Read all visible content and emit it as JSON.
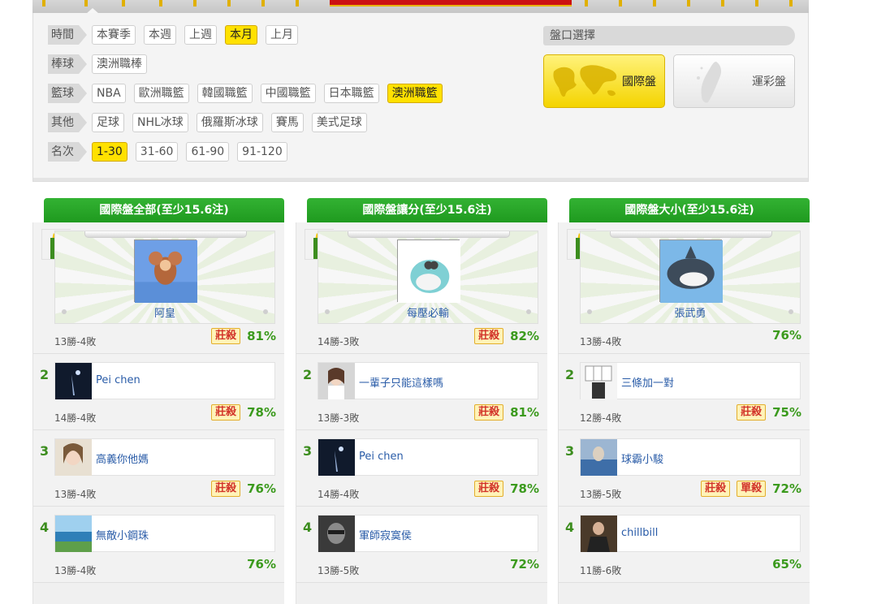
{
  "filters": {
    "time": {
      "label": "時間",
      "options": [
        "本賽季",
        "本週",
        "上週",
        "本月",
        "上月"
      ],
      "active": 3
    },
    "baseball": {
      "label": "棒球",
      "options": [
        "澳洲職棒"
      ],
      "active": -1
    },
    "basketball": {
      "label": "籃球",
      "options": [
        "NBA",
        "歐洲職籃",
        "韓國職籃",
        "中國職籃",
        "日本職籃",
        "澳洲職籃"
      ],
      "active": 5
    },
    "other": {
      "label": "其他",
      "options": [
        "足球",
        "NHL冰球",
        "俄羅斯冰球",
        "賽馬",
        "美式足球"
      ],
      "active": -1
    },
    "rank": {
      "label": "名次",
      "options": [
        "1-30",
        "31-60",
        "61-90",
        "91-120"
      ],
      "active": 0
    }
  },
  "odds": {
    "title": "盤口選擇",
    "international": "國際盤",
    "taiwan": "運彩盤"
  },
  "colors": {
    "accent_yellow": "#ffe100",
    "header_green": "#2aa52a",
    "pct_green": "#3b9a1d",
    "badge_red": "#d2342a"
  },
  "columns": [
    {
      "title": "國際盤全部(至少15.6注)",
      "entries": [
        {
          "rank": "1",
          "name": "阿皇",
          "record": "13勝-4敗",
          "badges": [
            "莊殺"
          ],
          "pct": "81%",
          "avatar": "jerry-mouse"
        },
        {
          "rank": "2",
          "name": "Pei chen",
          "record": "14勝-4敗",
          "badges": [
            "莊殺"
          ],
          "pct": "78%",
          "avatar": "dark-night"
        },
        {
          "rank": "3",
          "name": "高義你他媽",
          "record": "13勝-4敗",
          "badges": [
            "莊殺"
          ],
          "pct": "76%",
          "avatar": "woman-portrait"
        },
        {
          "rank": "4",
          "name": "無敵小鋼珠",
          "record": "13勝-4敗",
          "badges": [],
          "pct": "76%",
          "avatar": "sea-coast"
        }
      ]
    },
    {
      "title": "國際盤讓分(至少15.6注)",
      "entries": [
        {
          "rank": "1",
          "name": "每壓必輸",
          "record": "14勝-3敗",
          "badges": [
            "莊殺"
          ],
          "pct": "82%",
          "avatar": "cartoon-whale"
        },
        {
          "rank": "2",
          "name": "一輩子只能這樣嗎",
          "record": "13勝-3敗",
          "badges": [
            "莊殺"
          ],
          "pct": "81%",
          "avatar": "girl-portrait"
        },
        {
          "rank": "3",
          "name": "Pei chen",
          "record": "14勝-4敗",
          "badges": [
            "莊殺"
          ],
          "pct": "78%",
          "avatar": "dark-night"
        },
        {
          "rank": "4",
          "name": "軍師寂寞侯",
          "record": "13勝-5敗",
          "badges": [],
          "pct": "72%",
          "avatar": "man-portrait"
        }
      ]
    },
    {
      "title": "國際盤大小(至少15.6注)",
      "entries": [
        {
          "rank": "1",
          "name": "張武勇",
          "record": "13勝-4敗",
          "badges": [],
          "pct": "76%",
          "avatar": "cartoon-shark"
        },
        {
          "rank": "2",
          "name": "三條加一對",
          "record": "12勝-4敗",
          "badges": [
            "莊殺"
          ],
          "pct": "75%",
          "avatar": "playing-cards"
        },
        {
          "rank": "3",
          "name": "球霸小駿",
          "record": "13勝-5敗",
          "badges": [
            "莊殺",
            "單殺"
          ],
          "pct": "72%",
          "avatar": "blue-scene"
        },
        {
          "rank": "4",
          "name": "chillbill",
          "record": "11勝-6敗",
          "badges": [],
          "pct": "65%",
          "avatar": "man-suit"
        }
      ]
    }
  ]
}
